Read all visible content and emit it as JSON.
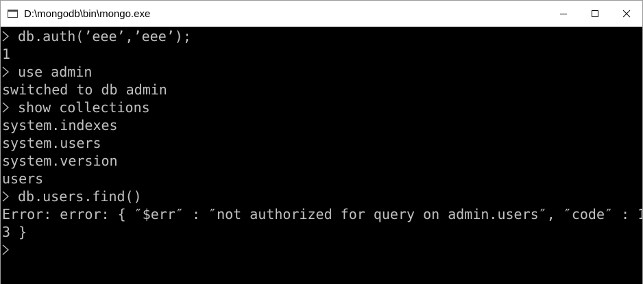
{
  "window": {
    "title": "D:\\mongodb\\bin\\mongo.exe",
    "app_icon": "console-window-icon",
    "controls": [
      "minimize-icon",
      "maximize-icon",
      "close-icon"
    ]
  },
  "console": {
    "colors": {
      "background": "#000000",
      "foreground": "#c0c0c0"
    },
    "lines": [
      {
        "type": "input",
        "text": "db.auth(’eee’,’eee’);"
      },
      {
        "type": "output",
        "text": "1"
      },
      {
        "type": "input",
        "text": "use admin"
      },
      {
        "type": "output",
        "text": "switched to db admin"
      },
      {
        "type": "input",
        "text": "show collections"
      },
      {
        "type": "output",
        "text": "system.indexes"
      },
      {
        "type": "output",
        "text": "system.users"
      },
      {
        "type": "output",
        "text": "system.version"
      },
      {
        "type": "output",
        "text": "users"
      },
      {
        "type": "input",
        "text": "db.users.find()"
      },
      {
        "type": "output",
        "text": "Error: error: { ″$err″ : ″not authorized for query on admin.users″, ″code″ : 1"
      },
      {
        "type": "output",
        "text": "3 }"
      },
      {
        "type": "prompt",
        "text": ""
      }
    ]
  }
}
